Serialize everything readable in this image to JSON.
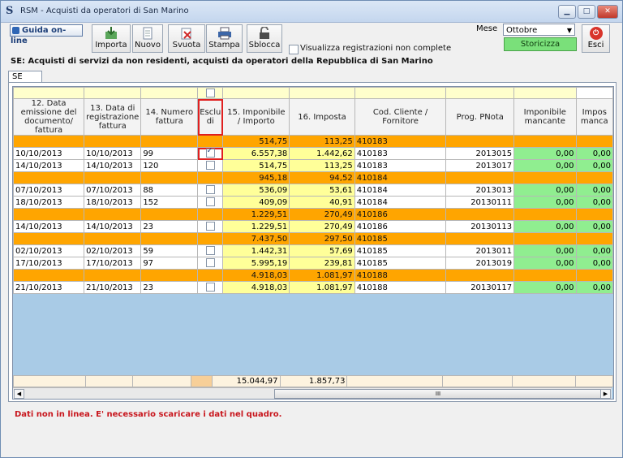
{
  "window": {
    "title": "RSM - Acquisti da operatori di San Marino",
    "icon": "app-s-icon"
  },
  "window_buttons": {
    "minimize": "▁",
    "maximize": "□",
    "close": "✕"
  },
  "help": {
    "label": "Guida on-line"
  },
  "toolbar": {
    "importa": "Importa",
    "nuovo": "Nuovo",
    "svuota": "Svuota",
    "stampa": "Stampa",
    "sblocca": "Sblocca"
  },
  "options": {
    "visualizza_label": "Visualizza registrazioni non complete",
    "visualizza_checked": false
  },
  "month": {
    "label": "Mese",
    "value": "Ottobre",
    "storicizza_label": "Storicizza"
  },
  "exit": {
    "label": "Esci"
  },
  "section_title": "SE: Acquisti di servizi da non residenti, acquisti da operatori della Repubblica di San Marino",
  "tab": {
    "label": "SE"
  },
  "table": {
    "columns": [
      "12. Data emissione del documento/ fattura",
      "13. Data di registrazione fattura",
      "14. Numero fattura",
      "Esclu di",
      "15. Imponibile / Importo",
      "16. Imposta",
      "Cod. Cliente / Fornitore",
      "Prog. PNota",
      "Imponibile mancante",
      "Impos manca"
    ],
    "groups": [
      {
        "imponibile": "514,75",
        "imposta": "113,25",
        "code": "410183",
        "rows": [
          {
            "data_emissione": "10/10/2013",
            "data_registrazione": "10/10/2013",
            "numero": "99",
            "escludi": true,
            "imponibile": "6.557,38",
            "imposta": "1.442,62",
            "codice": "410183",
            "pnota": "2013015",
            "imp_mancante": "0,00",
            "imposta_mancante": "0,00"
          },
          {
            "data_emissione": "14/10/2013",
            "data_registrazione": "14/10/2013",
            "numero": "120",
            "escludi": false,
            "imponibile": "514,75",
            "imposta": "113,25",
            "codice": "410183",
            "pnota": "2013017",
            "imp_mancante": "0,00",
            "imposta_mancante": "0,00"
          }
        ]
      },
      {
        "imponibile": "945,18",
        "imposta": "94,52",
        "code": "410184",
        "rows": [
          {
            "data_emissione": "07/10/2013",
            "data_registrazione": "07/10/2013",
            "numero": "88",
            "escludi": false,
            "imponibile": "536,09",
            "imposta": "53,61",
            "codice": "410184",
            "pnota": "2013013",
            "imp_mancante": "0,00",
            "imposta_mancante": "0,00"
          },
          {
            "data_emissione": "18/10/2013",
            "data_registrazione": "18/10/2013",
            "numero": "152",
            "escludi": false,
            "imponibile": "409,09",
            "imposta": "40,91",
            "codice": "410184",
            "pnota": "20130111",
            "imp_mancante": "0,00",
            "imposta_mancante": "0,00"
          }
        ]
      },
      {
        "imponibile": "1.229,51",
        "imposta": "270,49",
        "code": "410186",
        "rows": [
          {
            "data_emissione": "14/10/2013",
            "data_registrazione": "14/10/2013",
            "numero": "23",
            "escludi": false,
            "imponibile": "1.229,51",
            "imposta": "270,49",
            "codice": "410186",
            "pnota": "20130113",
            "imp_mancante": "0,00",
            "imposta_mancante": "0,00"
          }
        ]
      },
      {
        "imponibile": "7.437,50",
        "imposta": "297,50",
        "code": "410185",
        "rows": [
          {
            "data_emissione": "02/10/2013",
            "data_registrazione": "02/10/2013",
            "numero": "59",
            "escludi": false,
            "imponibile": "1.442,31",
            "imposta": "57,69",
            "codice": "410185",
            "pnota": "2013011",
            "imp_mancante": "0,00",
            "imposta_mancante": "0,00"
          },
          {
            "data_emissione": "17/10/2013",
            "data_registrazione": "17/10/2013",
            "numero": "97",
            "escludi": false,
            "imponibile": "5.995,19",
            "imposta": "239,81",
            "codice": "410185",
            "pnota": "2013019",
            "imp_mancante": "0,00",
            "imposta_mancante": "0,00"
          }
        ]
      },
      {
        "imponibile": "4.918,03",
        "imposta": "1.081,97",
        "code": "410188",
        "rows": [
          {
            "data_emissione": "21/10/2013",
            "data_registrazione": "21/10/2013",
            "numero": "23",
            "escludi": false,
            "imponibile": "4.918,03",
            "imposta": "1.081,97",
            "codice": "410188",
            "pnota": "20130117",
            "imp_mancante": "0,00",
            "imposta_mancante": "0,00"
          }
        ]
      }
    ],
    "totals": {
      "imponibile": "15.044,97",
      "imposta": "1.857,73"
    }
  },
  "scrollbar": {
    "left_arrow": "◀",
    "right_arrow": "▶",
    "grip": "III"
  },
  "status_message": "Dati non in linea. E' necessario scaricare i dati nel quadro.",
  "colors": {
    "group_row": "#ffa500",
    "amount_cell": "#ffff99",
    "missing_cell": "#90ee90",
    "highlight": "#e02020",
    "status_text": "#c8161d"
  }
}
